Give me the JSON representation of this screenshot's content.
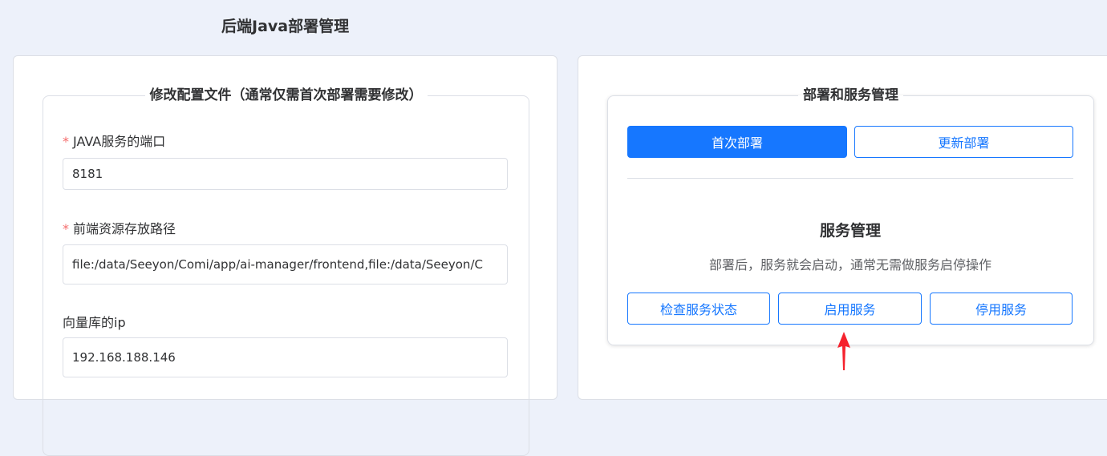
{
  "page": {
    "title": "后端Java部署管理"
  },
  "config_panel": {
    "legend": "修改配置文件（通常仅需首次部署需要修改）",
    "fields": [
      {
        "label": "JAVA服务的端口",
        "required": true,
        "value": "8181"
      },
      {
        "label": "前端资源存放路径",
        "required": true,
        "value": "file:/data/Seeyon/Comi/app/ai-manager/frontend,file:/data/Seeyon/C"
      },
      {
        "label": "向量库的ip",
        "required": false,
        "value": "192.168.188.146"
      }
    ],
    "required_mark": "*"
  },
  "deploy_panel": {
    "legend": "部署和服务管理",
    "first_deploy_label": "首次部署",
    "update_deploy_label": "更新部署",
    "service": {
      "title": "服务管理",
      "description": "部署后，服务就会启动，通常无需做服务启停操作",
      "check_label": "检查服务状态",
      "start_label": "启用服务",
      "stop_label": "停用服务"
    }
  },
  "annotation": {
    "arrow_color": "#f5222d",
    "arrow_icon": "up-arrow-icon"
  },
  "colors": {
    "primary": "#1677ff",
    "required": "#f56c6c",
    "background": "#edf1fa"
  }
}
